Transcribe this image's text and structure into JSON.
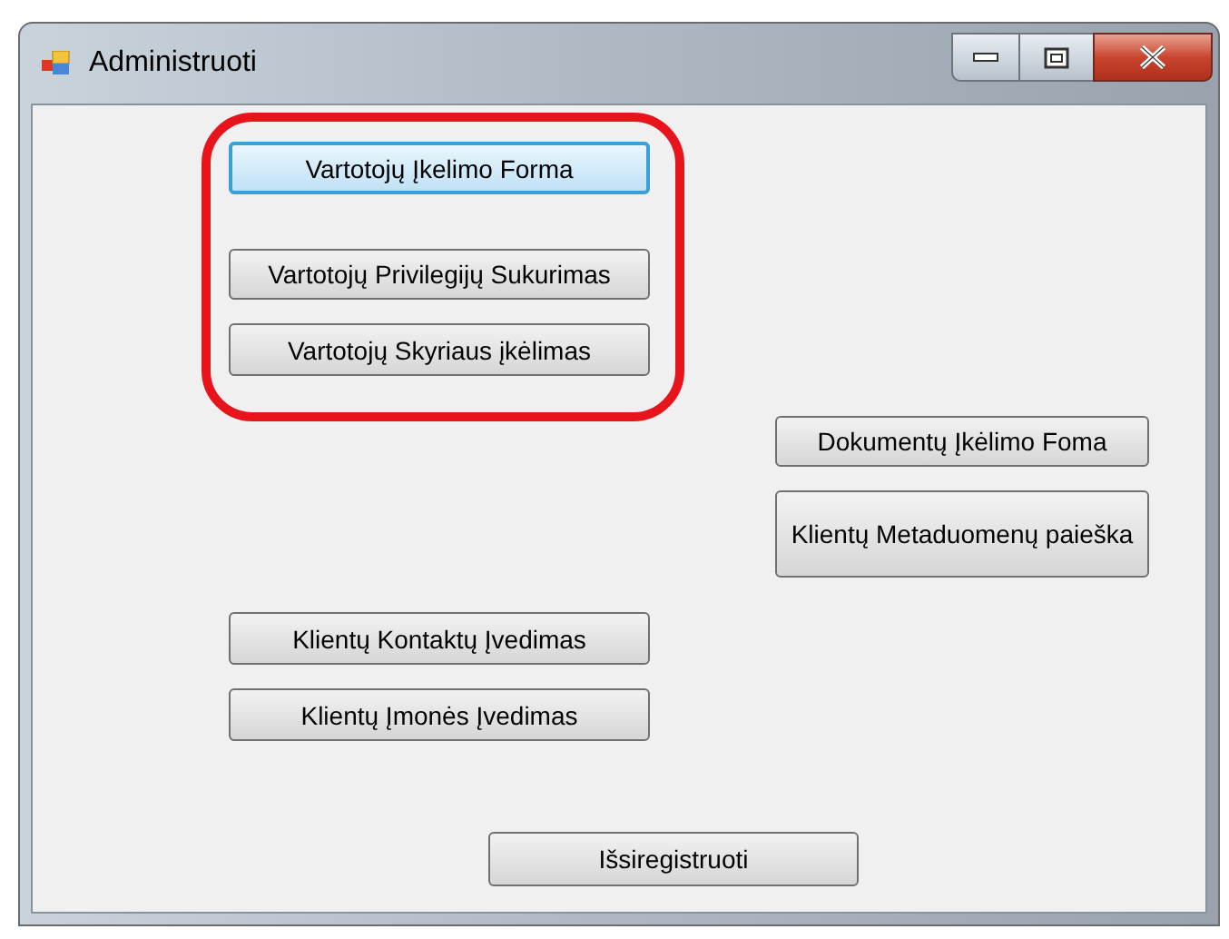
{
  "window": {
    "title": "Administruoti"
  },
  "buttons": [
    {
      "label": "Vartotojų Įkelimo Forma",
      "focused": true
    },
    {
      "label": "Vartotojų Privilegijų Sukurimas",
      "focused": false
    },
    {
      "label": "Vartotojų Skyriaus įkėlimas",
      "focused": false
    },
    {
      "label": "Dokumentų Įkėlimo Foma",
      "focused": false
    },
    {
      "label": "Klientų Metaduomenų paieška",
      "focused": false
    },
    {
      "label": "Klientų Kontaktų Įvedimas",
      "focused": false
    },
    {
      "label": "Klientų Įmonės Įvedimas",
      "focused": false
    },
    {
      "label": "Išsiregistruoti",
      "focused": false
    }
  ]
}
